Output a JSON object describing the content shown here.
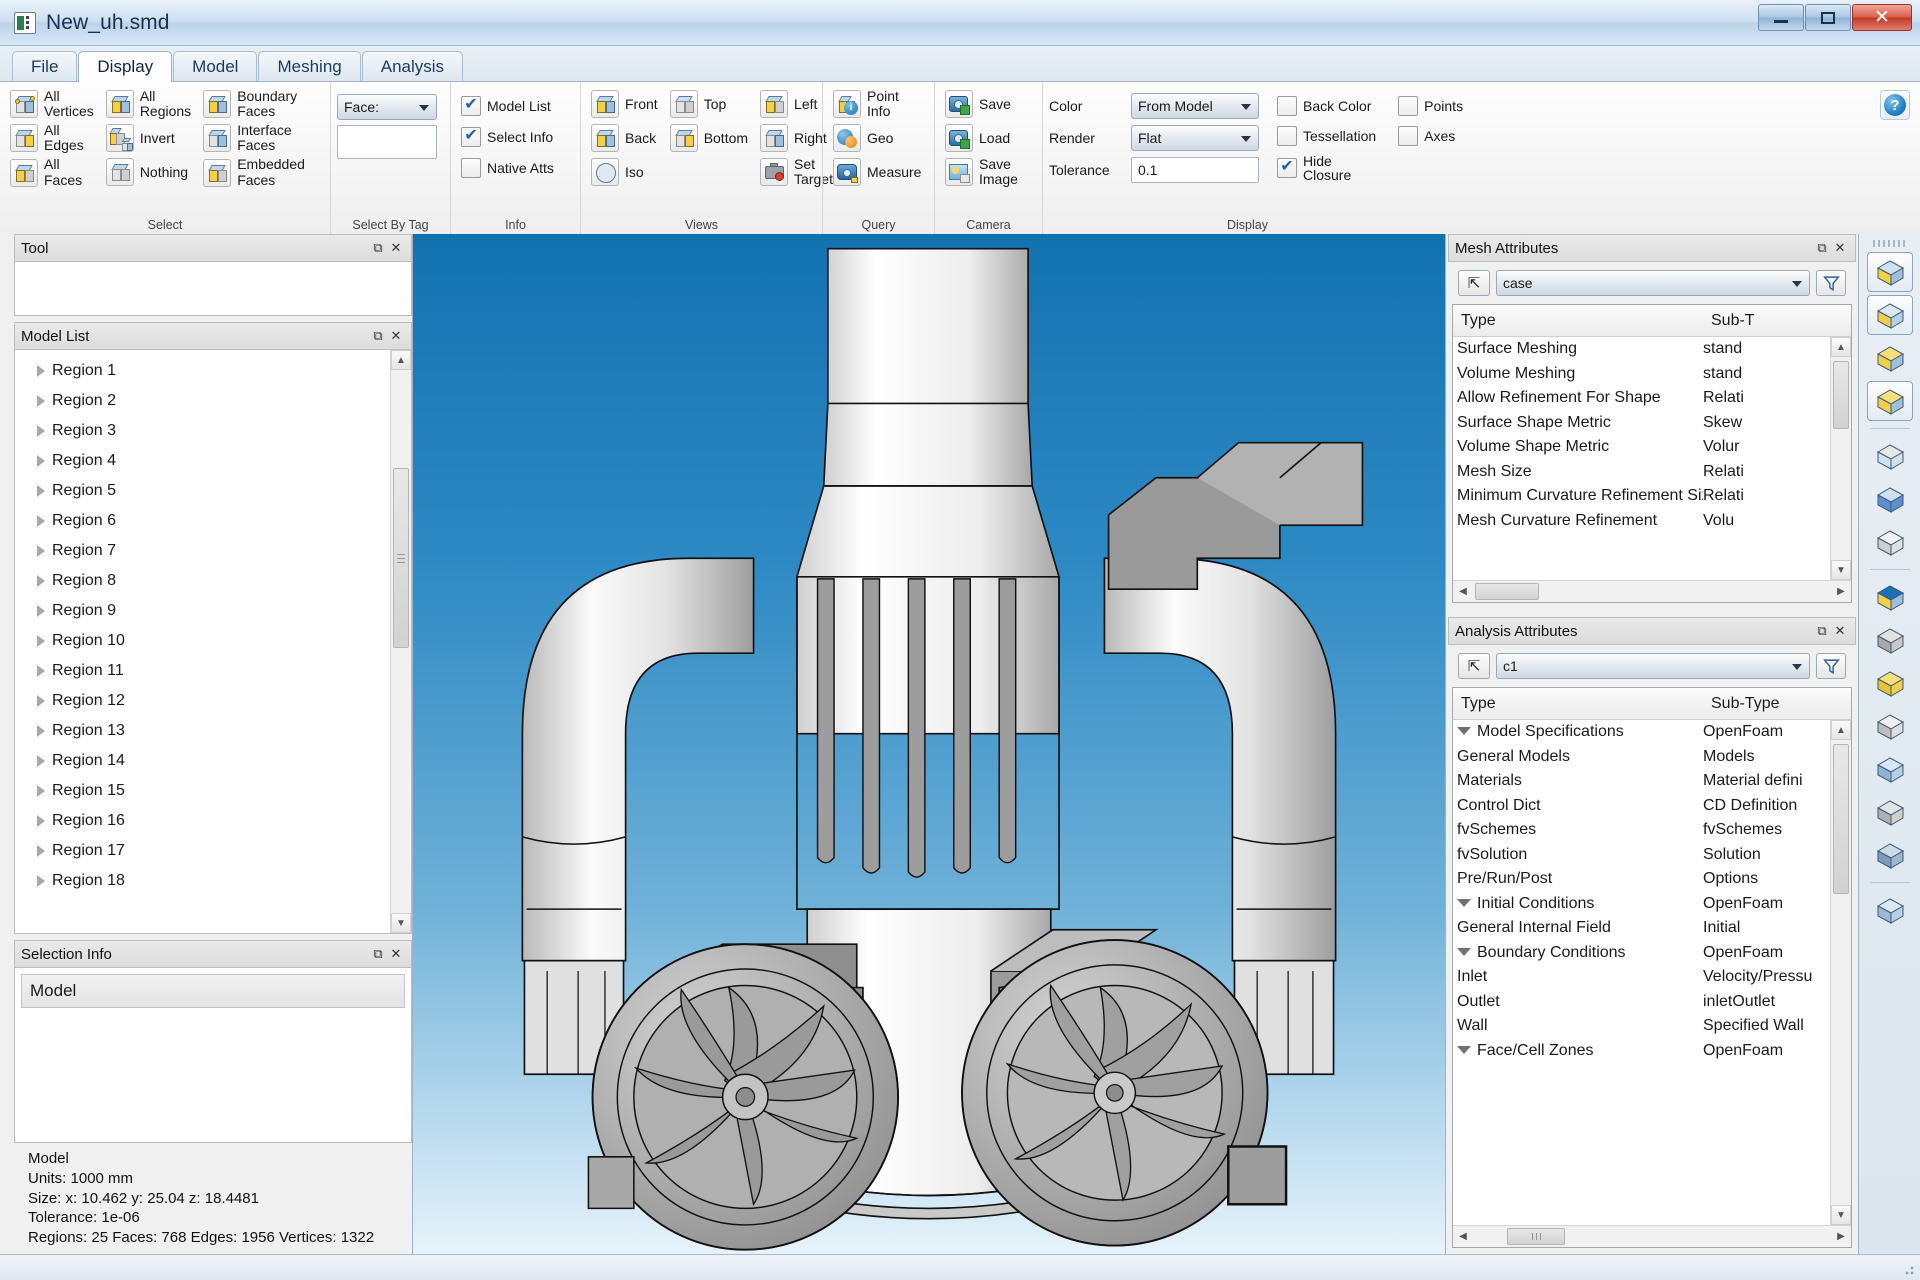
{
  "window": {
    "title": "New_uh.smd",
    "app_icon": "document-icon",
    "minimize": "minimize-icon",
    "maximize": "maximize-icon",
    "close": "✕"
  },
  "ribbon": {
    "tabs": [
      {
        "label": "File",
        "active": false
      },
      {
        "label": "Display",
        "active": true
      },
      {
        "label": "Model",
        "active": false
      },
      {
        "label": "Meshing",
        "active": false
      },
      {
        "label": "Analysis",
        "active": false
      }
    ],
    "help_label": "?",
    "groups": [
      {
        "name": "Select",
        "label": "Select",
        "columns": [
          {
            "items": [
              {
                "label": "All\nVertices",
                "line1": "All",
                "line2": "Vertices",
                "icon": "cube-vertices-icon"
              },
              {
                "label": "All\nEdges",
                "line1": "All",
                "line2": "Edges",
                "icon": "cube-edges-icon"
              },
              {
                "label": "All\nFaces",
                "line1": "All",
                "line2": "Faces",
                "icon": "cube-faces-icon"
              }
            ]
          },
          {
            "items": [
              {
                "label": "All Regions",
                "line1": "All",
                "line2": "Regions",
                "icon": "cube-regions-icon"
              },
              {
                "label": "Invert",
                "line1": "Invert",
                "line2": "",
                "icon": "invert-icon"
              },
              {
                "label": "Nothing",
                "line1": "Nothing",
                "line2": "",
                "icon": "nothing-icon"
              }
            ]
          },
          {
            "items": [
              {
                "label": "Boundary Faces",
                "line1": "Boundary",
                "line2": "Faces",
                "icon": "boundary-faces-icon"
              },
              {
                "label": "Interface Faces",
                "line1": "Interface",
                "line2": "Faces",
                "icon": "interface-faces-icon"
              },
              {
                "label": "Embedded Faces",
                "line1": "Embedded",
                "line2": "Faces",
                "icon": "embedded-faces-icon"
              }
            ]
          }
        ]
      },
      {
        "name": "Select By Tag",
        "label": "Select By Tag",
        "face_combo_label": "Face:",
        "face_combo_value": "",
        "tag_box_value": ""
      },
      {
        "name": "Info",
        "label": "Info",
        "checks": [
          {
            "label": "Model List",
            "checked": true
          },
          {
            "label": "Select Info",
            "checked": true
          },
          {
            "label": "Native Atts",
            "checked": false
          }
        ]
      },
      {
        "name": "Views",
        "label": "Views",
        "columns": [
          {
            "items": [
              {
                "label": "Front",
                "icon": "view-front-icon"
              },
              {
                "label": "Back",
                "icon": "view-back-icon"
              },
              {
                "label": "Iso",
                "icon": "view-iso-icon"
              }
            ]
          },
          {
            "items": [
              {
                "label": "Top",
                "icon": "view-top-icon"
              },
              {
                "label": "Bottom",
                "icon": "view-bottom-icon"
              }
            ]
          },
          {
            "items": [
              {
                "label": "Left",
                "icon": "view-left-icon"
              },
              {
                "label": "Right",
                "icon": "view-right-icon"
              },
              {
                "label": "Set Target",
                "line1": "Set",
                "line2": "Target",
                "icon": "set-target-icon"
              }
            ]
          }
        ]
      },
      {
        "name": "Query",
        "label": "Query",
        "items": [
          {
            "label": "Point Info",
            "line1": "Point",
            "line2": "Info",
            "icon": "point-info-icon"
          },
          {
            "label": "Geo",
            "line1": "Geo",
            "line2": "",
            "icon": "geo-icon"
          },
          {
            "label": "Measure",
            "line1": "Measure",
            "line2": "",
            "icon": "measure-icon"
          }
        ]
      },
      {
        "name": "Camera",
        "label": "Camera",
        "items": [
          {
            "label": "Save",
            "line1": "Save",
            "line2": "",
            "icon": "camera-save-icon"
          },
          {
            "label": "Load",
            "line1": "Load",
            "line2": "",
            "icon": "camera-load-icon"
          },
          {
            "label": "Save Image",
            "line1": "Save",
            "line2": "Image",
            "icon": "save-image-icon"
          }
        ]
      },
      {
        "name": "Display",
        "label": "Display",
        "fields": [
          {
            "label": "Color",
            "type": "combo",
            "value": "From Model"
          },
          {
            "label": "Render",
            "type": "combo",
            "value": "Flat"
          },
          {
            "label": "Tolerance",
            "type": "text",
            "value": "0.1"
          }
        ],
        "checks_col1": [
          {
            "label": "Back Color",
            "checked": false
          },
          {
            "label": "Tessellation",
            "checked": false
          },
          {
            "label": "Hide Closure",
            "checked": true
          }
        ],
        "checks_col2": [
          {
            "label": "Points",
            "checked": false
          },
          {
            "label": "Axes",
            "checked": false
          }
        ]
      }
    ]
  },
  "left_dock": {
    "tool_panel": {
      "title": "Tool"
    },
    "model_list_panel": {
      "title": "Model List",
      "items": [
        "Region 1",
        "Region 2",
        "Region 3",
        "Region 4",
        "Region 5",
        "Region 6",
        "Region 7",
        "Region 8",
        "Region 9",
        "Region 10",
        "Region 11",
        "Region 12",
        "Region 13",
        "Region 14",
        "Region 15",
        "Region 16",
        "Region 17",
        "Region 18"
      ]
    },
    "selection_info_panel": {
      "title": "Selection Info",
      "header_value": "Model",
      "stats": [
        "Model",
        "Units: 1000 mm",
        "Size: x: 10.462  y:  25.04  z: 18.4481",
        "Tolerance: 1e-06",
        "Regions: 25 Faces: 768 Edges: 1956 Vertices: 1322"
      ]
    }
  },
  "right_dock": {
    "mesh_attributes": {
      "title": "Mesh Attributes",
      "case_combo_value": "case",
      "add_button": "add-attribute-icon",
      "filter_button": "filter-icon",
      "columns": [
        "Type",
        "Sub-T"
      ],
      "rows": [
        {
          "type": "Surface Meshing",
          "subtype": "stand",
          "indent": 0
        },
        {
          "type": "Volume Meshing",
          "subtype": "stand",
          "indent": 0
        },
        {
          "type": "Allow Refinement For Shape",
          "subtype": "Relati",
          "indent": 0
        },
        {
          "type": "Surface Shape Metric",
          "subtype": "Skew",
          "indent": 0
        },
        {
          "type": "Volume Shape Metric",
          "subtype": "Volur",
          "indent": 0
        },
        {
          "type": "Mesh Size",
          "subtype": "Relati",
          "indent": 0
        },
        {
          "type": "Minimum Curvature Refinement Size",
          "subtype": "Relati",
          "indent": 0
        },
        {
          "type": "Mesh Curvature Refinement",
          "subtype": "Volu",
          "indent": 0
        }
      ]
    },
    "analysis_attributes": {
      "title": "Analysis Attributes",
      "case_combo_value": "c1",
      "add_button": "add-attribute-icon",
      "filter_button": "filter-icon",
      "columns": [
        "Type",
        "Sub-Type"
      ],
      "rows": [
        {
          "type": "Model Specifications",
          "subtype": "OpenFoam",
          "indent": 0,
          "expanded": true
        },
        {
          "type": "General Models",
          "subtype": "Models",
          "indent": 1
        },
        {
          "type": "Materials",
          "subtype": "Material defini",
          "indent": 1
        },
        {
          "type": "Control Dict",
          "subtype": "CD Definition",
          "indent": 1
        },
        {
          "type": "fvSchemes",
          "subtype": "fvSchemes",
          "indent": 1
        },
        {
          "type": "fvSolution",
          "subtype": "Solution",
          "indent": 1
        },
        {
          "type": "Pre/Run/Post",
          "subtype": "Options",
          "indent": 1
        },
        {
          "type": "Initial Conditions",
          "subtype": "OpenFoam",
          "indent": 0,
          "expanded": true
        },
        {
          "type": "General Internal Field",
          "subtype": "Initial",
          "indent": 1
        },
        {
          "type": "Boundary Conditions",
          "subtype": "OpenFoam",
          "indent": 0,
          "expanded": true
        },
        {
          "type": "Inlet",
          "subtype": "Velocity/Pressu",
          "indent": 1
        },
        {
          "type": "Outlet",
          "subtype": "inletOutlet",
          "indent": 1
        },
        {
          "type": "Wall",
          "subtype": "Specified Wall",
          "indent": 1
        },
        {
          "type": "Face/Cell Zones",
          "subtype": "OpenFoam",
          "indent": 0,
          "expanded": true
        }
      ]
    }
  },
  "rail": {
    "icons": [
      {
        "name": "show-hide-regions-icon",
        "selected": true
      },
      {
        "name": "cutaway-view-icon",
        "selected": true
      },
      {
        "name": "two-region-icon",
        "selected": false
      },
      {
        "name": "highlight-region-icon",
        "selected": true
      },
      {
        "name": "wireframe-refresh-icon",
        "selected": false
      },
      {
        "name": "mesh-nodes-icon",
        "selected": false
      },
      {
        "name": "solid-block-icon",
        "selected": false
      },
      {
        "name": "region-info-icon",
        "selected": false
      },
      {
        "name": "grey-slab-icon",
        "selected": false
      },
      {
        "name": "face-pick-icon",
        "selected": false
      },
      {
        "name": "light-slab-icon",
        "selected": false
      },
      {
        "name": "blue-slab-icon",
        "selected": false
      },
      {
        "name": "hollow-slab-icon",
        "selected": false
      },
      {
        "name": "slab-refresh-icon",
        "selected": false
      },
      {
        "name": "open-box-icon",
        "selected": false
      }
    ]
  },
  "viewport": {
    "name": "3d-model-viewport",
    "model_description": "CAD assembly: vertical pumping column with two curved elbow pipes and two volute pump impeller casings"
  }
}
